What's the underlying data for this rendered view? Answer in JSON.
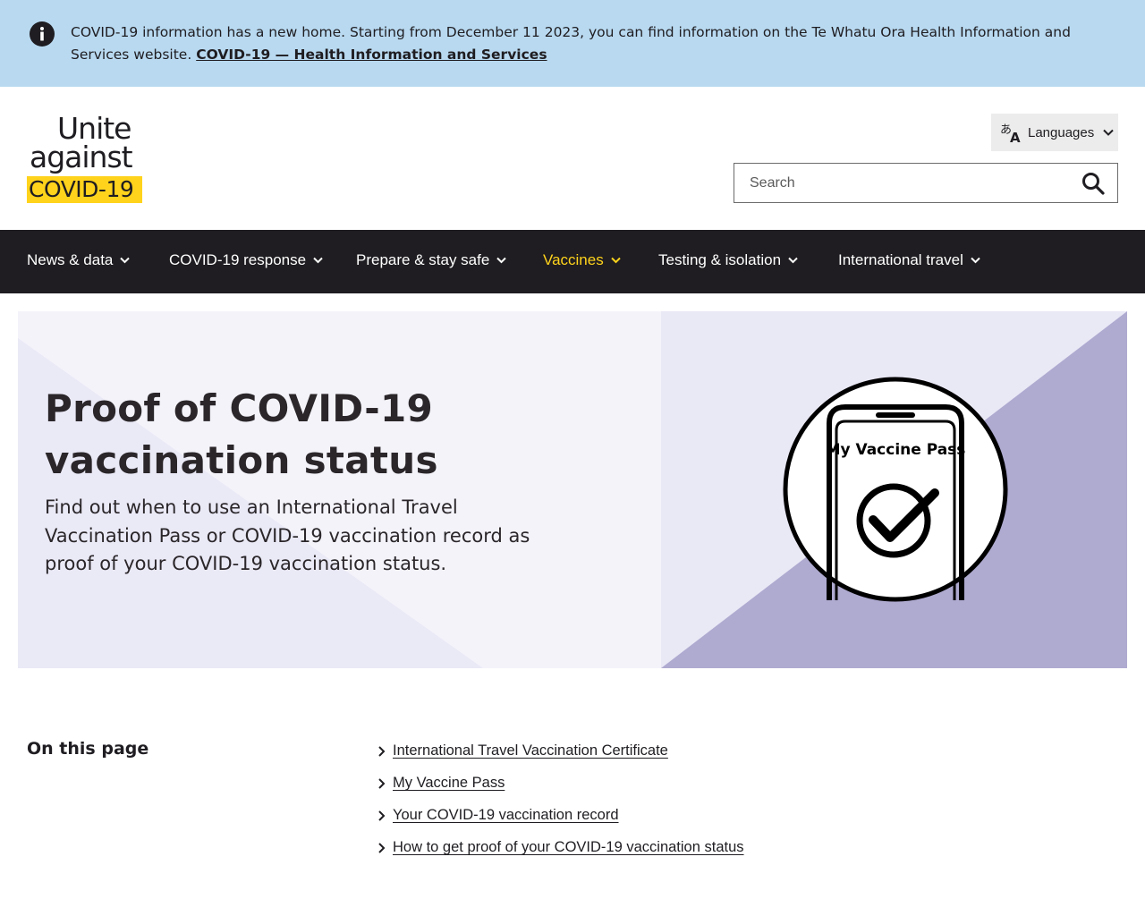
{
  "alert": {
    "text": "COVID-19 information has a new home. Starting from December 11 2023, you can find information on the Te Whatu Ora Health Information and Services website.",
    "link_label": "COVID-19 — Health Information and Services",
    "icon": "info-icon",
    "background": "#b8d9f0"
  },
  "header": {
    "logo": {
      "line1": "Unite",
      "line2": "against",
      "line3": "COVID-19"
    },
    "languages_label": "Languages",
    "search_placeholder": "Search"
  },
  "nav": {
    "items": [
      {
        "label": "News & data",
        "active": false
      },
      {
        "label": "COVID-19 response",
        "active": false
      },
      {
        "label": "Prepare & stay safe",
        "active": false
      },
      {
        "label": "Vaccines",
        "active": true
      },
      {
        "label": "Testing & isolation",
        "active": false
      },
      {
        "label": "International travel",
        "active": false
      }
    ],
    "background": "#1f1d21",
    "active_color": "#ffd31c"
  },
  "hero": {
    "title": "Proof of COVID-19 vaccination status",
    "subtitle": "Find out when to use an International Travel Vaccination Pass or COVID-19 vaccination record as proof of your COVID-19 vaccination status.",
    "illustration_label": "My Vaccine Pass",
    "accent": "#aeaad0"
  },
  "on_this_page": {
    "heading": "On this page",
    "links": [
      "International Travel Vaccination Certificate",
      "My Vaccine Pass",
      "Your COVID-19 vaccination record",
      "How to get proof of your COVID-19 vaccination status"
    ]
  }
}
